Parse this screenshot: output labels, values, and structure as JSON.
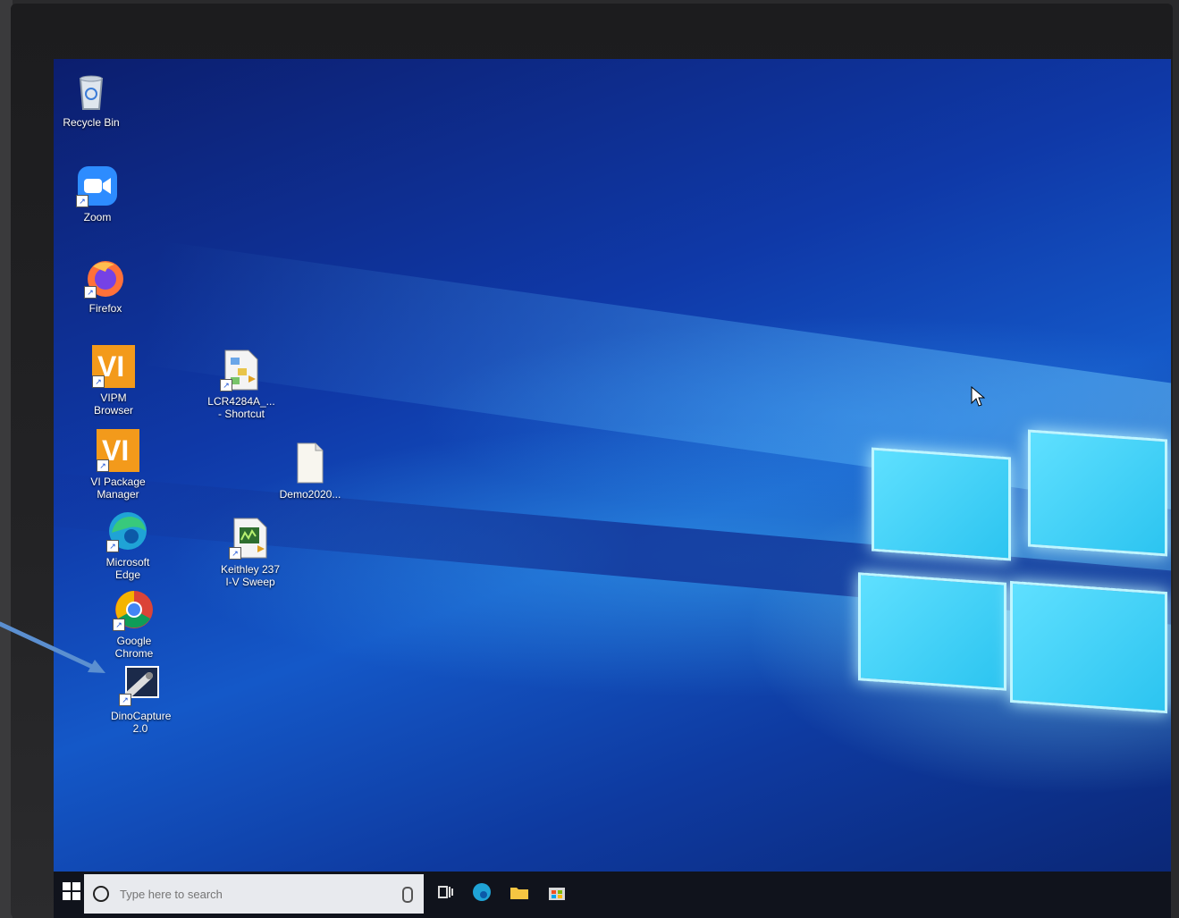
{
  "desktop": {
    "icons": [
      {
        "label": "Recycle Bin"
      },
      {
        "label": "Zoom"
      },
      {
        "label": "Firefox"
      },
      {
        "label": "VIPM Browser"
      },
      {
        "label": "VI Package Manager"
      },
      {
        "label": "Microsoft Edge"
      },
      {
        "label": "Google Chrome"
      },
      {
        "label": "DinoCapture 2.0"
      },
      {
        "label": "LCR4284A_... - Shortcut"
      },
      {
        "label": "Demo2020..."
      },
      {
        "label": "Keithley 237 I-V Sweep"
      }
    ],
    "vi_logo_text": "VI"
  },
  "taskbar": {
    "search_placeholder": "Type here to search"
  },
  "colors": {
    "wallpaper": "#1458c8",
    "taskbar": "#10131c",
    "annotation_arrow": "#5b8fd0"
  }
}
